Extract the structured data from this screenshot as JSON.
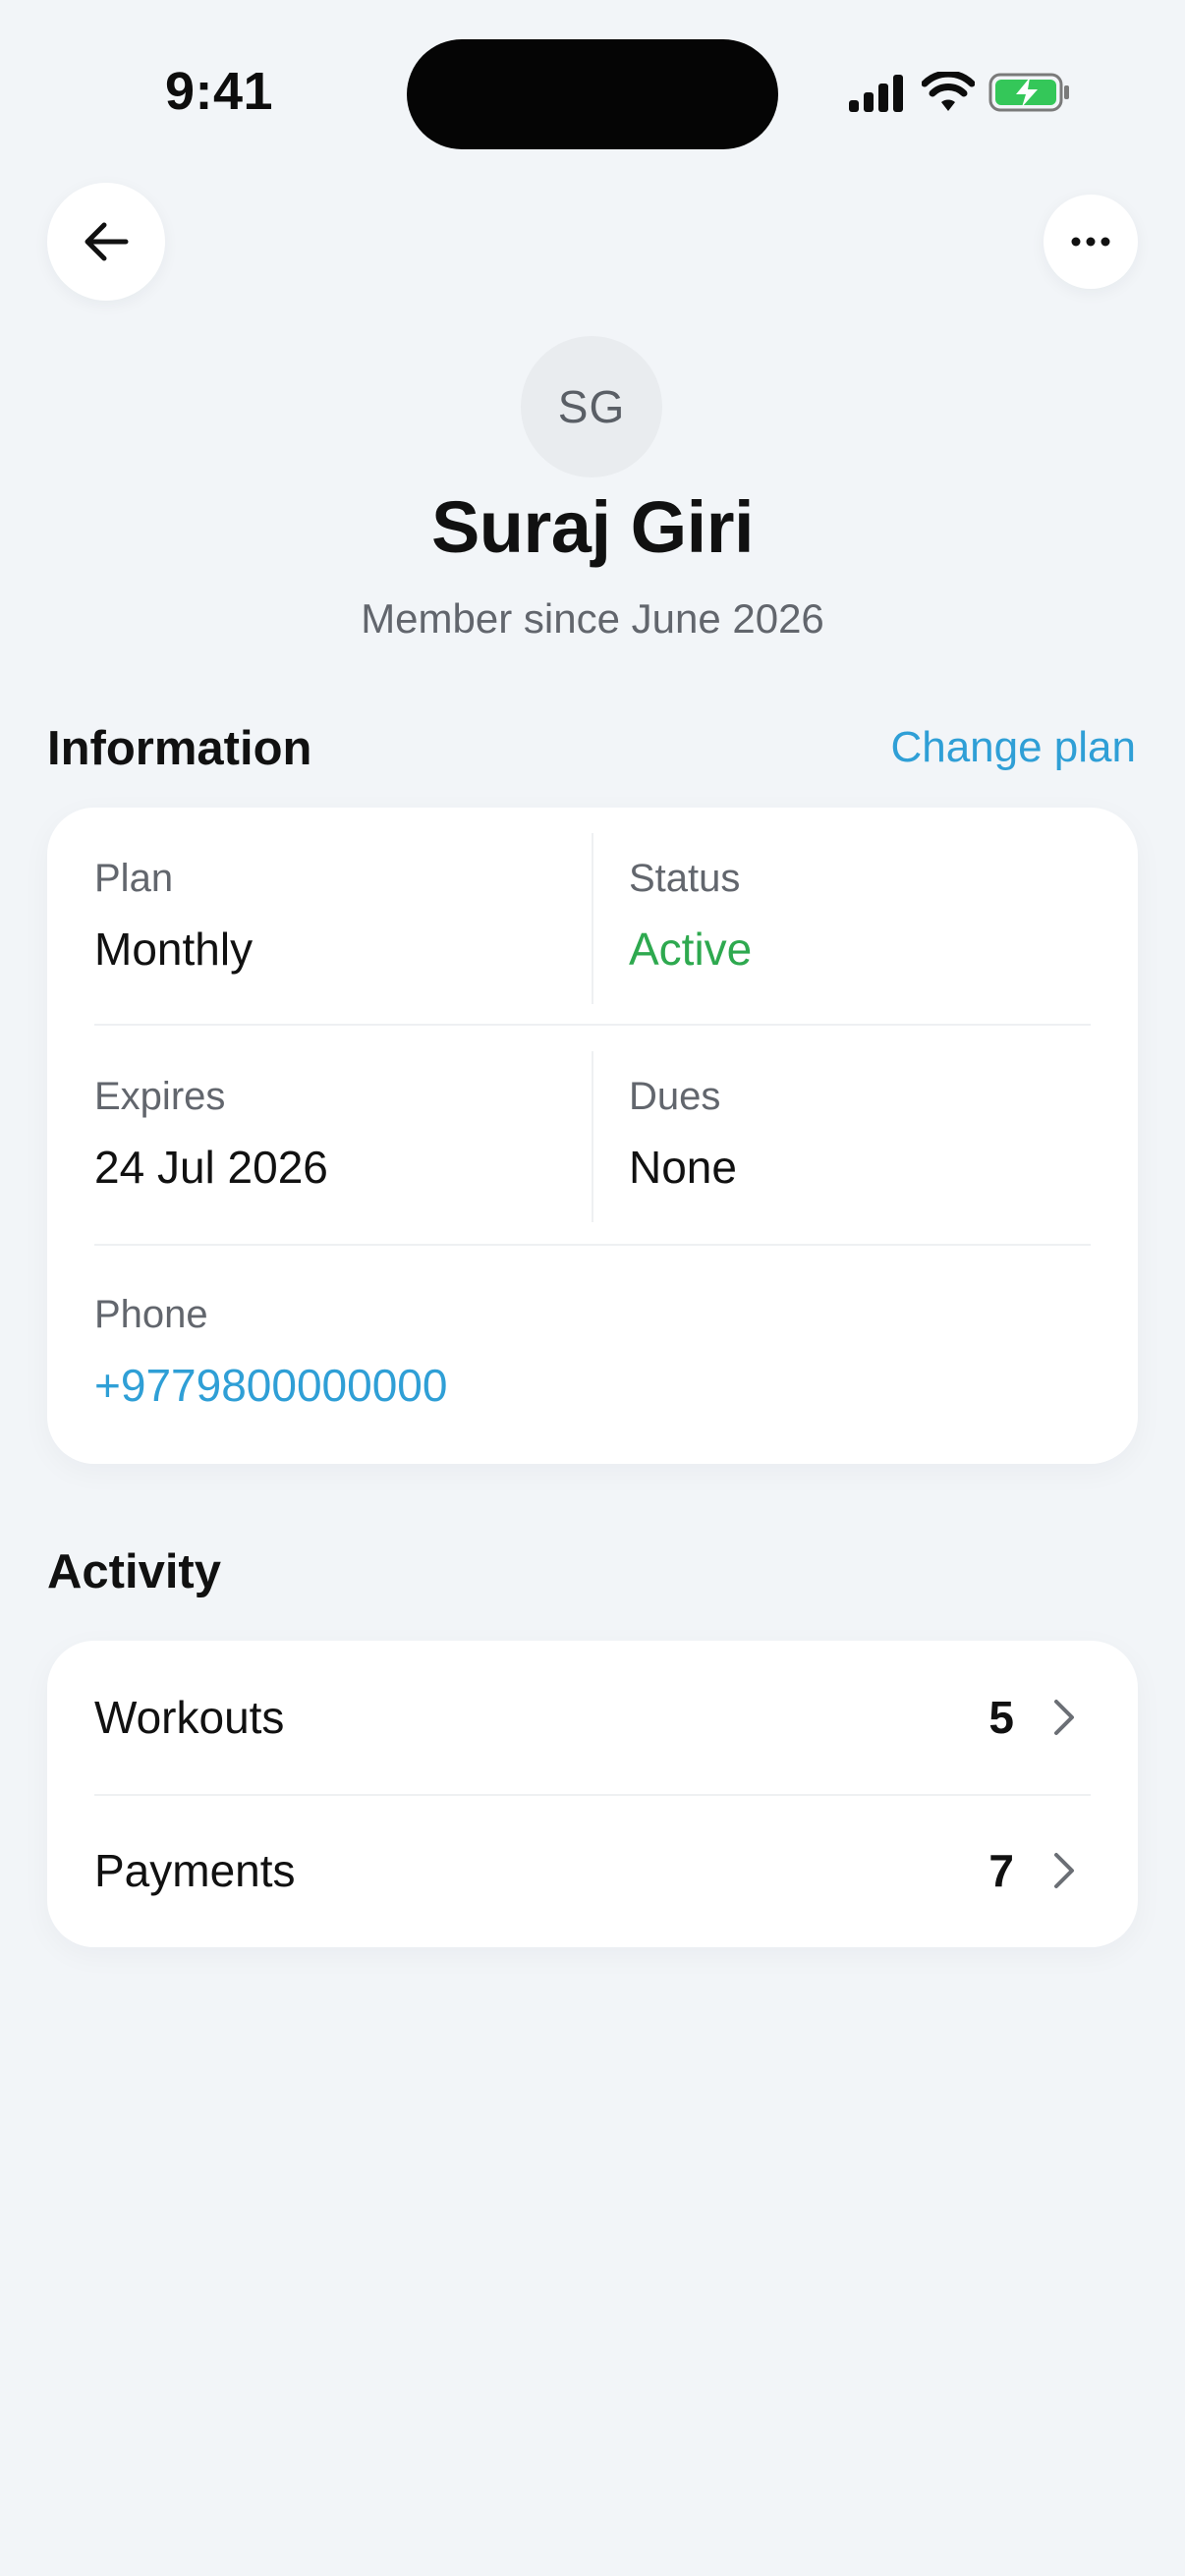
{
  "status_bar": {
    "time": "9:41"
  },
  "header": {
    "back_icon": "arrow-left-icon",
    "more_icon": "ellipsis-icon"
  },
  "profile": {
    "initials": "SG",
    "name": "Suraj Giri",
    "member_since": "Member since June 2026"
  },
  "information": {
    "title": "Information",
    "action_label": "Change plan",
    "plan_label": "Plan",
    "plan_value": "Monthly",
    "status_label": "Status",
    "status_value": "Active",
    "expires_label": "Expires",
    "expires_value": "24 Jul 2026",
    "dues_label": "Dues",
    "dues_value": "None",
    "phone_label": "Phone",
    "phone_value": "+9779800000000"
  },
  "activity": {
    "title": "Activity",
    "items": [
      {
        "label": "Workouts",
        "count": "5"
      },
      {
        "label": "Payments",
        "count": "7"
      }
    ]
  },
  "colors": {
    "background": "#f2f5f8",
    "accent": "#2f9fd6",
    "status_active": "#2ea94f",
    "battery": "#34c759"
  }
}
